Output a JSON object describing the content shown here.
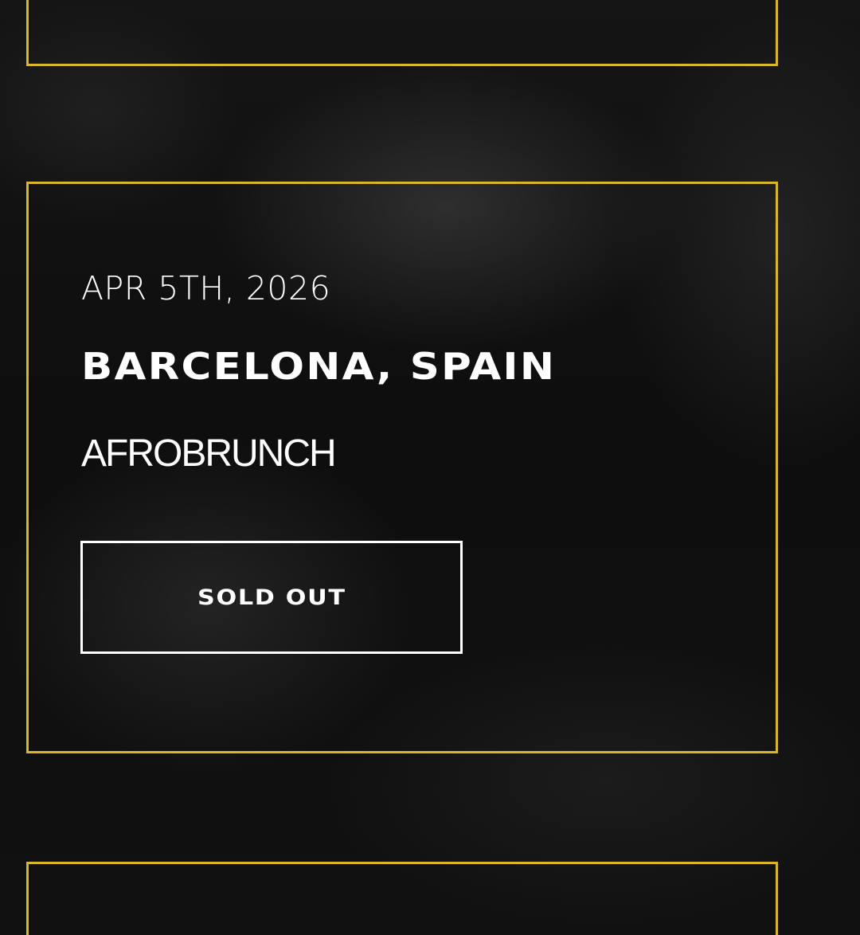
{
  "colors": {
    "background": "#0c0c0c",
    "card_border": "#d9b62a",
    "text": "#ffffff",
    "button_border": "#ffffff"
  },
  "event": {
    "date": "APR 5TH, 2026",
    "location": "BARCELONA, SPAIN",
    "name": "AFROBRUNCH",
    "button_label": "SOLD OUT"
  }
}
